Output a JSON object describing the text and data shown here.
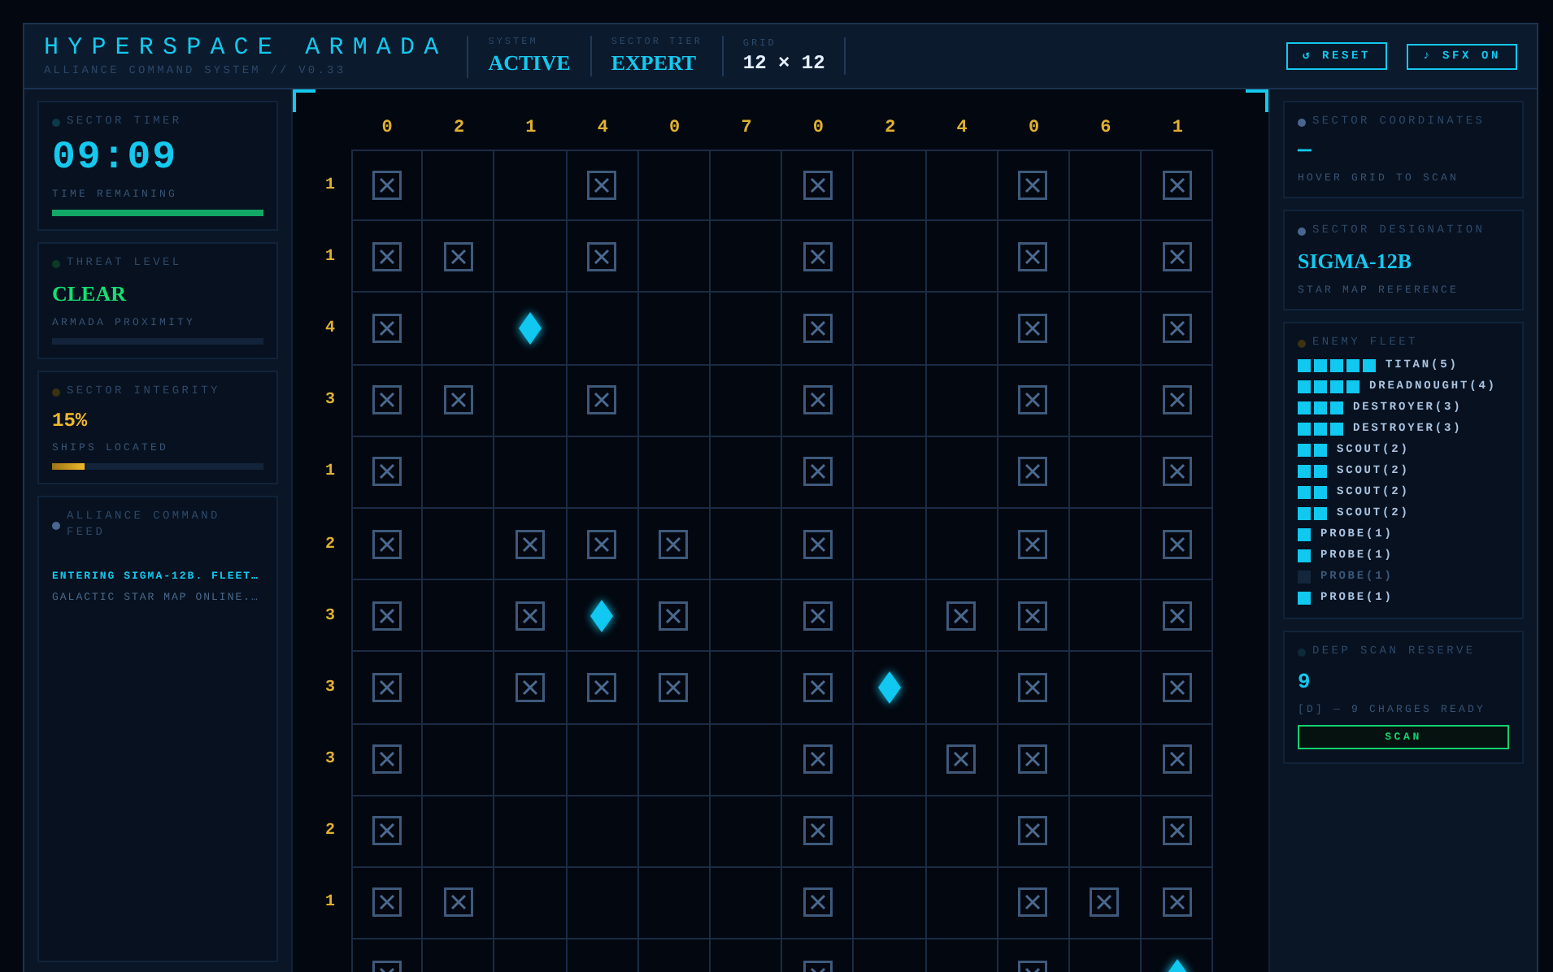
{
  "header": {
    "title": "HYPERSPACE ARMADA",
    "subtitle": "ALLIANCE COMMAND SYSTEM // V0.33",
    "stats": [
      {
        "label": "SYSTEM",
        "value": "ACTIVE",
        "kind": "accent"
      },
      {
        "label": "SECTOR TIER",
        "value": "EXPERT",
        "kind": "accent"
      },
      {
        "label": "GRID",
        "value": "12 × 12",
        "kind": "plain"
      }
    ],
    "buttons": [
      "↺ RESET",
      "♪ SFX ON"
    ]
  },
  "left": {
    "timer": {
      "title": "SECTOR TIMER",
      "value": "09:09",
      "caption": "TIME REMAINING",
      "level": 1
    },
    "threat": {
      "title": "THREAT LEVEL",
      "value": "CLEAR",
      "caption": "ARMADA PROXIMITY",
      "level": 0
    },
    "integrity": {
      "title": "SECTOR INTEGRITY",
      "value": "15%",
      "caption": "SHIPS LOCATED",
      "level": 0.15
    },
    "feed": {
      "title": "ALLIANCE COMMAND FEED",
      "lines": [
        {
          "text": "ENTERING SIGMA-12B. FLEET…",
          "kind": "highlight"
        },
        {
          "text": "GALACTIC STAR MAP ONLINE.…",
          "kind": "normal"
        }
      ]
    }
  },
  "board": {
    "column_counts": [
      "0",
      "2",
      "1",
      "4",
      "0",
      "7",
      "0",
      "2",
      "4",
      "0",
      "6",
      "1"
    ],
    "rows": [
      {
        "count": "1",
        "cells": [
          {
            "kind": "miss"
          },
          {
            "kind": "empty"
          },
          {
            "kind": "empty"
          },
          {
            "kind": "miss"
          },
          {
            "kind": "empty"
          },
          {
            "kind": "empty"
          },
          {
            "kind": "miss"
          },
          {
            "kind": "empty"
          },
          {
            "kind": "empty"
          },
          {
            "kind": "miss"
          },
          {
            "kind": "empty"
          },
          {
            "kind": "miss"
          }
        ]
      },
      {
        "count": "1",
        "cells": [
          {
            "kind": "miss"
          },
          {
            "kind": "miss"
          },
          {
            "kind": "empty"
          },
          {
            "kind": "miss"
          },
          {
            "kind": "empty"
          },
          {
            "kind": "empty"
          },
          {
            "kind": "miss"
          },
          {
            "kind": "empty"
          },
          {
            "kind": "empty"
          },
          {
            "kind": "miss"
          },
          {
            "kind": "empty"
          },
          {
            "kind": "miss"
          }
        ]
      },
      {
        "count": "4",
        "cells": [
          {
            "kind": "miss"
          },
          {
            "kind": "empty"
          },
          {
            "kind": "ship"
          },
          {
            "kind": "empty"
          },
          {
            "kind": "empty"
          },
          {
            "kind": "empty"
          },
          {
            "kind": "miss"
          },
          {
            "kind": "empty"
          },
          {
            "kind": "empty"
          },
          {
            "kind": "miss"
          },
          {
            "kind": "empty"
          },
          {
            "kind": "miss"
          }
        ]
      },
      {
        "count": "3",
        "cells": [
          {
            "kind": "miss"
          },
          {
            "kind": "miss"
          },
          {
            "kind": "empty"
          },
          {
            "kind": "miss"
          },
          {
            "kind": "empty"
          },
          {
            "kind": "empty"
          },
          {
            "kind": "miss"
          },
          {
            "kind": "empty"
          },
          {
            "kind": "empty"
          },
          {
            "kind": "miss"
          },
          {
            "kind": "empty"
          },
          {
            "kind": "miss"
          }
        ]
      },
      {
        "count": "1",
        "cells": [
          {
            "kind": "miss"
          },
          {
            "kind": "empty"
          },
          {
            "kind": "empty"
          },
          {
            "kind": "empty"
          },
          {
            "kind": "empty"
          },
          {
            "kind": "empty"
          },
          {
            "kind": "miss"
          },
          {
            "kind": "empty"
          },
          {
            "kind": "empty"
          },
          {
            "kind": "miss"
          },
          {
            "kind": "empty"
          },
          {
            "kind": "miss"
          }
        ]
      },
      {
        "count": "2",
        "cells": [
          {
            "kind": "miss"
          },
          {
            "kind": "empty"
          },
          {
            "kind": "miss"
          },
          {
            "kind": "miss"
          },
          {
            "kind": "miss"
          },
          {
            "kind": "empty"
          },
          {
            "kind": "miss"
          },
          {
            "kind": "empty"
          },
          {
            "kind": "empty"
          },
          {
            "kind": "miss"
          },
          {
            "kind": "empty"
          },
          {
            "kind": "miss"
          }
        ]
      },
      {
        "count": "3",
        "cells": [
          {
            "kind": "miss"
          },
          {
            "kind": "empty"
          },
          {
            "kind": "miss"
          },
          {
            "kind": "ship"
          },
          {
            "kind": "miss"
          },
          {
            "kind": "empty"
          },
          {
            "kind": "miss"
          },
          {
            "kind": "empty"
          },
          {
            "kind": "miss"
          },
          {
            "kind": "miss"
          },
          {
            "kind": "empty"
          },
          {
            "kind": "miss"
          }
        ]
      },
      {
        "count": "3",
        "cells": [
          {
            "kind": "miss"
          },
          {
            "kind": "empty"
          },
          {
            "kind": "miss"
          },
          {
            "kind": "miss"
          },
          {
            "kind": "miss"
          },
          {
            "kind": "empty"
          },
          {
            "kind": "miss"
          },
          {
            "kind": "ship"
          },
          {
            "kind": "empty"
          },
          {
            "kind": "miss"
          },
          {
            "kind": "empty"
          },
          {
            "kind": "miss"
          }
        ]
      },
      {
        "count": "3",
        "cells": [
          {
            "kind": "miss"
          },
          {
            "kind": "empty"
          },
          {
            "kind": "empty"
          },
          {
            "kind": "empty"
          },
          {
            "kind": "empty"
          },
          {
            "kind": "empty"
          },
          {
            "kind": "miss"
          },
          {
            "kind": "empty"
          },
          {
            "kind": "miss"
          },
          {
            "kind": "miss"
          },
          {
            "kind": "empty"
          },
          {
            "kind": "miss"
          }
        ]
      },
      {
        "count": "2",
        "cells": [
          {
            "kind": "miss"
          },
          {
            "kind": "empty"
          },
          {
            "kind": "empty"
          },
          {
            "kind": "empty"
          },
          {
            "kind": "empty"
          },
          {
            "kind": "empty"
          },
          {
            "kind": "miss"
          },
          {
            "kind": "empty"
          },
          {
            "kind": "empty"
          },
          {
            "kind": "miss"
          },
          {
            "kind": "empty"
          },
          {
            "kind": "miss"
          }
        ]
      },
      {
        "count": "1",
        "cells": [
          {
            "kind": "miss"
          },
          {
            "kind": "miss"
          },
          {
            "kind": "empty"
          },
          {
            "kind": "empty"
          },
          {
            "kind": "empty"
          },
          {
            "kind": "empty"
          },
          {
            "kind": "miss"
          },
          {
            "kind": "empty"
          },
          {
            "kind": "empty"
          },
          {
            "kind": "miss"
          },
          {
            "kind": "miss"
          },
          {
            "kind": "miss"
          }
        ]
      },
      {
        "cells": [
          {
            "kind": "miss"
          },
          {
            "kind": "empty"
          },
          {
            "kind": "empty"
          },
          {
            "kind": "empty"
          },
          {
            "kind": "empty"
          },
          {
            "kind": "empty"
          },
          {
            "kind": "miss"
          },
          {
            "kind": "empty"
          },
          {
            "kind": "empty"
          },
          {
            "kind": "miss"
          },
          {
            "kind": "empty"
          },
          {
            "kind": "ship"
          }
        ]
      }
    ]
  },
  "right": {
    "coordinates": {
      "title": "SECTOR COORDINATES",
      "value": "—",
      "caption": "HOVER GRID TO SCAN"
    },
    "designation": {
      "title": "SECTOR DESIGNATION",
      "value": "SIGMA-12B",
      "caption": "STAR MAP REFERENCE"
    },
    "fleet": {
      "title": "ENEMY FLEET",
      "ships": [
        {
          "name": "TITAN(5)",
          "kind": "titan",
          "destroyed": false
        },
        {
          "name": "DREADNOUGHT(4)",
          "kind": "dreadnought",
          "destroyed": false
        },
        {
          "name": "DESTROYER(3)",
          "kind": "destroyer",
          "destroyed": false
        },
        {
          "name": "DESTROYER(3)",
          "kind": "destroyer",
          "destroyed": false
        },
        {
          "name": "SCOUT(2)",
          "kind": "scout",
          "destroyed": false
        },
        {
          "name": "SCOUT(2)",
          "kind": "scout",
          "destroyed": false
        },
        {
          "name": "SCOUT(2)",
          "kind": "scout",
          "destroyed": false
        },
        {
          "name": "SCOUT(2)",
          "kind": "scout",
          "destroyed": false
        },
        {
          "name": "PROBE(1)",
          "kind": "probe",
          "destroyed": false
        },
        {
          "name": "PROBE(1)",
          "kind": "probe",
          "destroyed": false
        },
        {
          "name": "PROBE(1)",
          "kind": "probe",
          "destroyed": true
        },
        {
          "name": "PROBE(1)",
          "kind": "probe",
          "destroyed": false
        }
      ]
    },
    "scan": {
      "title": "DEEP SCAN RESERVE",
      "value": "9",
      "caption": "[D] — 9 CHARGES READY",
      "button": "SCAN"
    }
  }
}
